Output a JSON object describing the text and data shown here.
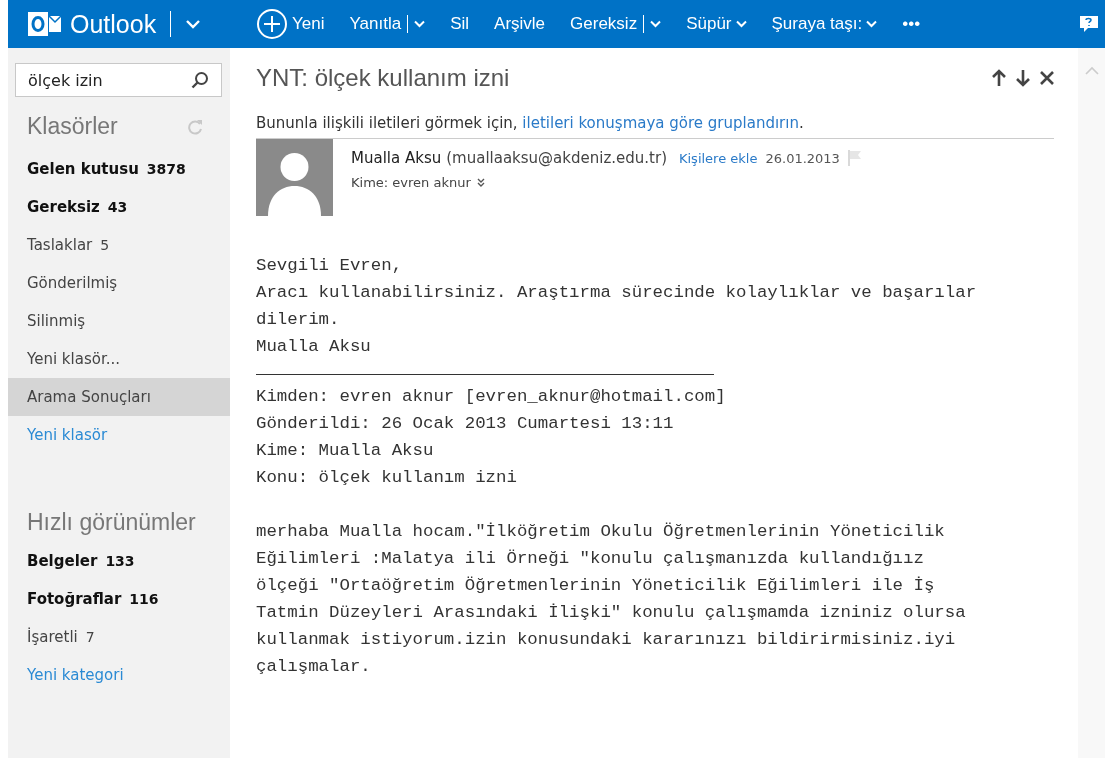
{
  "app": {
    "name": "Outlook"
  },
  "toolbar": [
    {
      "kind": "new",
      "label": "Yeni"
    },
    {
      "kind": "split",
      "label": "Yanıtla"
    },
    {
      "kind": "plain",
      "label": "Sil"
    },
    {
      "kind": "plain",
      "label": "Arşivle"
    },
    {
      "kind": "split",
      "label": "Gereksiz"
    },
    {
      "kind": "dropdown",
      "label": "Süpür"
    },
    {
      "kind": "dropdown",
      "label": "Şuraya taşı:"
    },
    {
      "kind": "plain",
      "label": "•••"
    }
  ],
  "search": {
    "value": "ölçek izin"
  },
  "folders": {
    "title": "Klasörler",
    "items": [
      {
        "kind": "folder",
        "label": "Gelen kutusu",
        "count": "3878",
        "unread": true,
        "selected": false
      },
      {
        "kind": "folder",
        "label": "Gereksiz",
        "count": "43",
        "unread": true,
        "selected": false
      },
      {
        "kind": "folder",
        "label": "Taslaklar",
        "count": "5",
        "unread": false,
        "selected": false
      },
      {
        "kind": "folder",
        "label": "Gönderilmiş",
        "unread": false,
        "selected": false
      },
      {
        "kind": "folder",
        "label": "Silinmiş",
        "unread": false,
        "selected": false
      },
      {
        "kind": "folder",
        "label": "Yeni klasör...",
        "unread": false,
        "selected": false
      },
      {
        "kind": "folder",
        "label": "Arama Sonuçları",
        "unread": false,
        "selected": true
      },
      {
        "kind": "link",
        "label": "Yeni klasör"
      }
    ]
  },
  "quick_views": {
    "title": "Hızlı görünümler",
    "items": [
      {
        "kind": "folder",
        "label": "Belgeler",
        "count": "133",
        "unread": true,
        "selected": false
      },
      {
        "kind": "folder",
        "label": "Fotoğraflar",
        "count": "116",
        "unread": true,
        "selected": false
      },
      {
        "kind": "folder",
        "label": "İşaretli",
        "count": "7",
        "unread": false,
        "selected": false
      },
      {
        "kind": "link",
        "label": "Yeni kategori"
      }
    ]
  },
  "message": {
    "subject": "YNT: ölçek kullanım izni",
    "notice": "Bununla ilişkili iletileri görmek için, ",
    "notice_link": "iletileri konuşmaya göre gruplandırın",
    "notice_end": ".",
    "sender": "Mualla Aksu",
    "sender_email": "(muallaaksu@akdeniz.edu.tr)",
    "add_contact": "Kişilere ekle",
    "date": "26.01.2013",
    "to": "Kime: evren aknur",
    "body_top": [
      "Sevgili Evren,",
      "Aracı kullanabilirsiniz. Araştırma sürecinde kolaylıklar ve başarılar",
      "dilerim.",
      "Mualla Aksu"
    ],
    "quoted_header": [
      "Kimden: evren aknur [evren_aknur@hotmail.com]",
      "Gönderildi: 26 Ocak 2013 Cumartesi 13:11",
      "Kime: Mualla Aksu",
      "Konu: ölçek kullanım izni"
    ],
    "quoted_body": [
      "merhaba Mualla hocam.\"İlköğretim Okulu Öğretmenlerinin Yöneticilik",
      "Eğilimleri :Malatya ili Örneği \"konulu çalışmanızda kullandığıız",
      "ölçeği \"Ortaöğretim Öğretmenlerinin Yöneticilik Eğilimleri ile İş",
      "Tatmin Düzeyleri Arasındaki İlişki\" konulu çalışmamda izniniz olursa",
      "kullanmak istiyorum.izin konusundaki kararınızı bildirirmisiniz.iyi",
      "çalışmalar."
    ]
  }
}
